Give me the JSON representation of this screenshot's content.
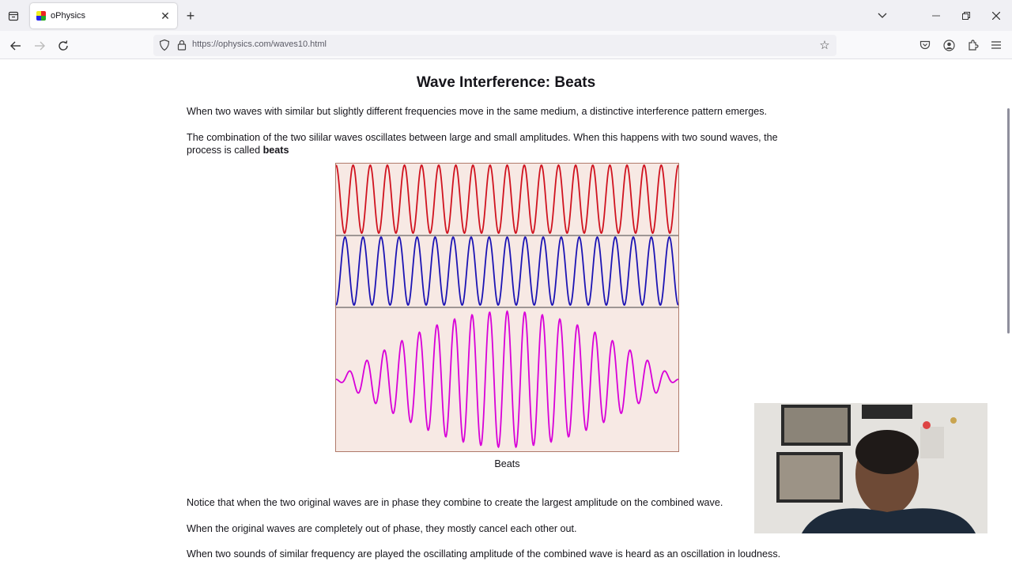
{
  "browser": {
    "tab_title": "oPhysics",
    "url": "https://ophysics.com/waves10.html"
  },
  "page": {
    "title": "Wave Interference: Beats",
    "para1": "When two waves with similar but slightly different frequencies move in the same medium, a distinctive interference pattern emerges.",
    "para2_pre": "The combination of the two sililar waves oscillates between large and small amplitudes. When this happens with two sound waves, the process is called ",
    "para2_bold": "beats",
    "caption": "Beats",
    "para3": "Notice that when the two original waves are in phase they combine to create the largest amplitude on the combined wave.",
    "para4": "When the original waves are completely out of phase, they mostly cancel each other out.",
    "para5": "When two sounds of similar frequency are played the oscillating amplitude of the combined wave is heard as an oscillation in loudness."
  },
  "colors": {
    "wave1": "#d0131f",
    "wave2": "#1c14b4",
    "combined": "#d800d8",
    "figure_bg": "#f7e9e4"
  },
  "icons": [
    "tab-list-icon",
    "close-icon",
    "plus-icon",
    "chevron-down-icon",
    "minimize-icon",
    "restore-icon",
    "back-icon",
    "forward-icon",
    "reload-icon",
    "shield-icon",
    "lock-icon",
    "star-icon",
    "pocket-icon",
    "account-icon",
    "extensions-icon",
    "menu-icon"
  ]
}
